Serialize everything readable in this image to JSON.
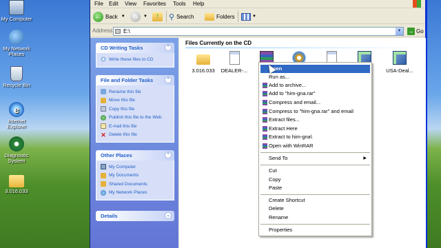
{
  "desktop": {
    "icons": [
      {
        "label": "My Computer",
        "icon": "my-computer-icon"
      },
      {
        "label": "My Network Places",
        "icon": "network-places-icon"
      },
      {
        "label": "Recycle Bin",
        "icon": "recycle-bin-icon"
      },
      {
        "label": "Internet Explorer",
        "icon": "internet-explorer-icon"
      },
      {
        "label": "Diagnostic System",
        "icon": "diagnostic-icon"
      },
      {
        "label": "3.016.033",
        "icon": "folder-icon"
      }
    ]
  },
  "window": {
    "menu": [
      "File",
      "Edit",
      "View",
      "Favorites",
      "Tools",
      "Help"
    ],
    "toolbar": {
      "back": "Back",
      "search": "Search",
      "folders": "Folders"
    },
    "address": {
      "label": "Address",
      "value": "E:\\",
      "go": "Go"
    }
  },
  "taskpane": {
    "panels": [
      {
        "title": "CD Writing Tasks",
        "items": [
          "Write these files to CD"
        ]
      },
      {
        "title": "File and Folder Tasks",
        "items": [
          "Rename this file",
          "Move this file",
          "Copy this file",
          "Publish this file to the Web",
          "E-mail this file",
          "Delete this file"
        ]
      },
      {
        "title": "Other Places",
        "items": [
          "My Computer",
          "My Documents",
          "Shared Documents",
          "My Network Places"
        ]
      },
      {
        "title": "Details",
        "items": []
      }
    ]
  },
  "content": {
    "section_title": "Files Currently on the CD",
    "files": [
      {
        "name": "3.016.033",
        "type": "folder"
      },
      {
        "name": "DEALER-...",
        "type": "document"
      },
      {
        "name": "",
        "type": "rar"
      },
      {
        "name": "",
        "type": "disc"
      },
      {
        "name": "",
        "type": "document"
      },
      {
        "name": "...na",
        "type": "setup"
      },
      {
        "name": "USA-Deal...",
        "type": "setup"
      }
    ]
  },
  "context_menu": {
    "items": [
      {
        "label": "Open",
        "bold": true,
        "highlighted": true
      },
      {
        "label": "Run as..."
      },
      {
        "label": "Add to archive...",
        "icon": "winrar-icon"
      },
      {
        "label": "Add to \"him-gna.rar\"",
        "icon": "winrar-icon"
      },
      {
        "label": "Compress and email...",
        "icon": "winrar-icon"
      },
      {
        "label": "Compress to \"him-gna.rar\" and email",
        "icon": "winrar-icon"
      },
      {
        "label": "Extract files...",
        "icon": "winrar-icon"
      },
      {
        "label": "Extract Here",
        "icon": "winrar-icon"
      },
      {
        "label": "Extract to him-gna\\",
        "icon": "winrar-icon"
      },
      {
        "label": "Open with WinRAR",
        "icon": "winrar-icon"
      },
      {
        "label": "Send To",
        "submenu": true
      },
      {
        "label": "Cut"
      },
      {
        "label": "Copy"
      },
      {
        "label": "Paste"
      },
      {
        "label": "Create Shortcut"
      },
      {
        "label": "Delete"
      },
      {
        "label": "Rename"
      },
      {
        "label": "Properties"
      }
    ]
  }
}
